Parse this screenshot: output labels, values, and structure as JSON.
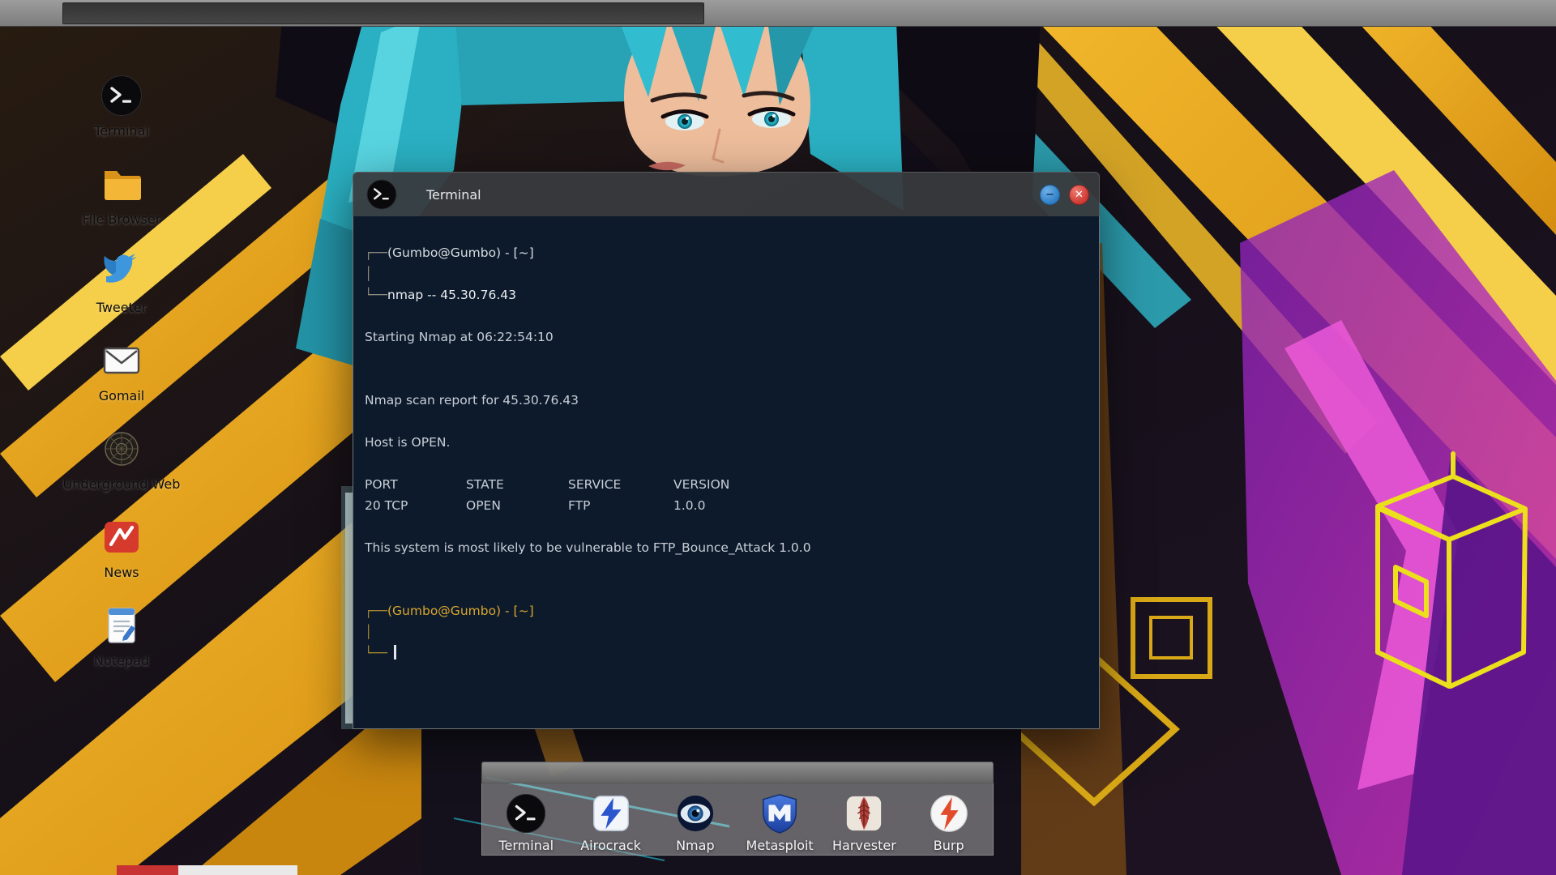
{
  "desktop_icons": [
    {
      "id": "terminal",
      "label": "Terminal"
    },
    {
      "id": "file-browser",
      "label": "File Browser"
    },
    {
      "id": "tweeter",
      "label": "Tweeter"
    },
    {
      "id": "gomail",
      "label": "Gomail"
    },
    {
      "id": "underground-web",
      "label": "Underground Web"
    },
    {
      "id": "news",
      "label": "News"
    },
    {
      "id": "notepad",
      "label": "Notepad"
    }
  ],
  "window": {
    "title": "Terminal",
    "controls": {
      "minimize": "−",
      "close": "✕"
    }
  },
  "terminal": {
    "prompt1": {
      "frame_top": "┌──",
      "user": "(Gumbo@Gumbo) - [~]",
      "frame_mid": "│",
      "frame_bottom": "└──",
      "command": "nmap -- 45.30.76.43"
    },
    "starting_line": "Starting Nmap at 06:22:54:10",
    "report_line": "Nmap scan report for 45.30.76.43",
    "host_line": "Host is OPEN.",
    "table": {
      "headers": [
        "PORT",
        "STATE",
        "SERVICE",
        "VERSION"
      ],
      "row": [
        "20 TCP",
        "OPEN",
        "FTP",
        "1.0.0"
      ]
    },
    "vuln_line": "This system is most likely to be vulnerable to FTP_Bounce_Attack 1.0.0",
    "prompt2": {
      "frame_top": "┌──",
      "user": "(Gumbo@Gumbo) - [~]",
      "frame_mid": "│",
      "frame_bottom": "└──"
    }
  },
  "dock": {
    "items": [
      {
        "id": "terminal",
        "label": "Terminal"
      },
      {
        "id": "airocrack",
        "label": "Airocrack"
      },
      {
        "id": "nmap",
        "label": "Nmap"
      },
      {
        "id": "metasploit",
        "label": "Metasploit"
      },
      {
        "id": "harvester",
        "label": "Harvester"
      },
      {
        "id": "burp",
        "label": "Burp"
      }
    ]
  },
  "colors": {
    "terminal_bg": "#0c1a2b",
    "terminal_text": "#c9ced6",
    "prompt_gold": "#d9a62e",
    "minimize_blue": "#2f7fc6",
    "close_red": "#cc3a33",
    "wallpaper_gold": "#e8a81f",
    "wallpaper_teal": "#2ab0c2",
    "wallpaper_magenta": "#d633c2"
  }
}
